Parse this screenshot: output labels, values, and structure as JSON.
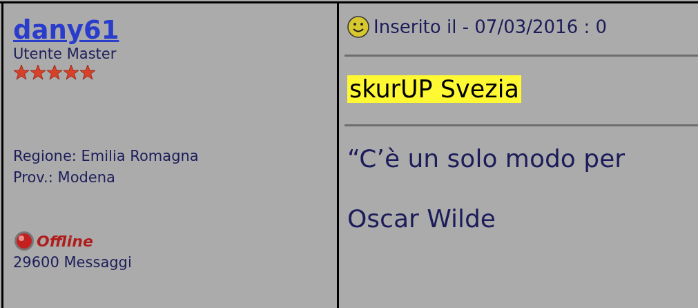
{
  "author": {
    "name": "dany61",
    "rank": "Utente Master",
    "stars": 5,
    "region": "Regione: Emilia Romagna",
    "province": "Prov.: Modena",
    "status": "Offline",
    "online": false,
    "messages": "29600 Messaggi"
  },
  "post": {
    "posted": "Inserito il - 07/03/2016 : 0",
    "title": "skurUP Svezia",
    "lines": [
      "“C’è un solo modo per",
      "Oscar Wilde"
    ]
  }
}
